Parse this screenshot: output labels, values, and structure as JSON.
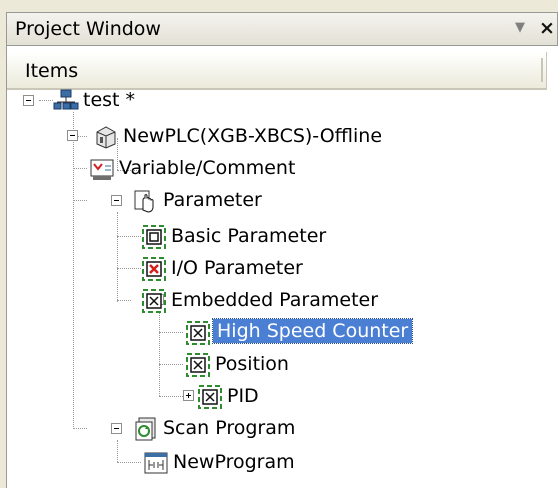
{
  "window": {
    "title": "Project Window",
    "pin_icon": "dropdown-arrow-icon",
    "close_icon": "close-icon"
  },
  "header": {
    "label": "Items"
  },
  "tree": {
    "project": {
      "label": "test *",
      "icon": "project-network-icon"
    },
    "plc": {
      "label": "NewPLC(XGB-XBCS)-Offline",
      "icon": "plc-cube-icon"
    },
    "variable": {
      "label": "Variable/Comment",
      "icon": "variable-comment-icon"
    },
    "parameter": {
      "label": "Parameter",
      "icon": "parameter-hand-icon"
    },
    "basic": {
      "label": "Basic Parameter",
      "icon": "basic-parameter-icon"
    },
    "io": {
      "label": "I/O Parameter",
      "icon": "io-parameter-icon"
    },
    "embedded": {
      "label": "Embedded Parameter",
      "icon": "embedded-parameter-icon"
    },
    "hsc": {
      "label": "High Speed Counter",
      "icon": "high-speed-counter-icon"
    },
    "position": {
      "label": "Position",
      "icon": "position-icon"
    },
    "pid": {
      "label": "PID",
      "icon": "pid-icon"
    },
    "scan": {
      "label": "Scan Program",
      "icon": "scan-program-icon"
    },
    "program": {
      "label": "NewProgram",
      "icon": "program-icon"
    }
  },
  "colors": {
    "selection": "#4a7fd4",
    "param_frame": "#2e8b2e",
    "io_red": "#d42020"
  }
}
